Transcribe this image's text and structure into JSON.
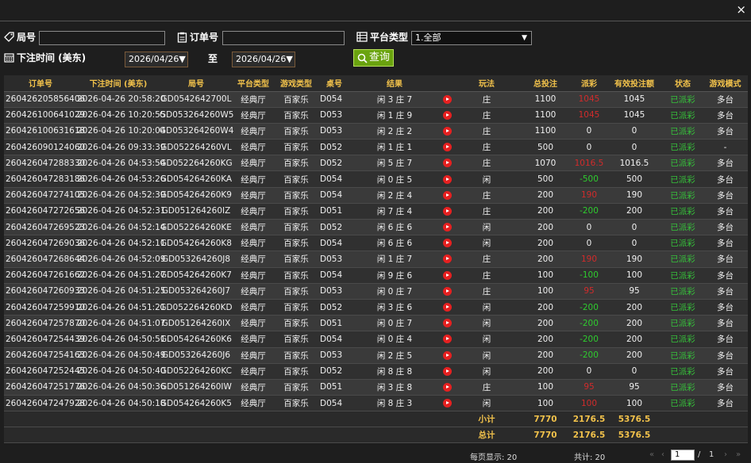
{
  "window": {
    "close_label": "×"
  },
  "filters": {
    "round_label": "局号",
    "order_label": "订单号",
    "platform_label": "平台类型",
    "platform_value": "1.全部",
    "time_label": "下注时间 (美东)",
    "date_from": "2026/04/26▼",
    "to_label": "至",
    "date_to": "2026/04/26▼",
    "query_label": "查询"
  },
  "table": {
    "headers": [
      "订单号",
      "下注时间 (美东)",
      "局号",
      "平台类型",
      "游戏类型",
      "桌号",
      "结果",
      "",
      "玩法",
      "总投注",
      "派彩",
      "有效投注额",
      "状态",
      "游戏模式"
    ],
    "rows": [
      [
        "260426205856406",
        "2026-04-26 20:58:20",
        "GD0542642700L",
        "经典厅",
        "百家乐",
        "D054",
        "闲 3 庄 7",
        "庄",
        "1100",
        "1045",
        "1045",
        "已派彩",
        "多台",
        "red"
      ],
      [
        "260426100641029",
        "2026-04-26 10:20:55",
        "GD053264260W5",
        "经典厅",
        "百家乐",
        "D053",
        "闲 1 庄 9",
        "庄",
        "1100",
        "1045",
        "1045",
        "已派彩",
        "多台",
        "red"
      ],
      [
        "260426100631618",
        "2026-04-26 10:20:04",
        "GD053264260W4",
        "经典厅",
        "百家乐",
        "D053",
        "闲 2 庄 2",
        "庄",
        "1100",
        "0",
        "0",
        "已派彩",
        "多台",
        ""
      ],
      [
        "260426090124060",
        "2026-04-26 09:33:39",
        "GD052264260VL",
        "经典厅",
        "百家乐",
        "D052",
        "闲 1 庄 1",
        "庄",
        "500",
        "0",
        "0",
        "已派彩",
        "-",
        ""
      ],
      [
        "260426047288330",
        "2026-04-26 04:53:54",
        "GD052264260KG",
        "经典厅",
        "百家乐",
        "D052",
        "闲 5 庄 7",
        "庄",
        "1070",
        "1016.5",
        "1016.5",
        "已派彩",
        "多台",
        "red"
      ],
      [
        "260426047283186",
        "2026-04-26 04:53:26",
        "GD054264260KA",
        "经典厅",
        "百家乐",
        "D054",
        "闲 0 庄 5",
        "闲",
        "500",
        "-500",
        "500",
        "已派彩",
        "多台",
        "neg"
      ],
      [
        "260426047274105",
        "2026-04-26 04:52:39",
        "GD054264260K9",
        "经典厅",
        "百家乐",
        "D054",
        "闲 2 庄 4",
        "庄",
        "200",
        "190",
        "190",
        "已派彩",
        "多台",
        "red"
      ],
      [
        "260426047272656",
        "2026-04-26 04:52:31",
        "GD051264260IZ",
        "经典厅",
        "百家乐",
        "D051",
        "闲 7 庄 4",
        "庄",
        "200",
        "-200",
        "200",
        "已派彩",
        "多台",
        "neg"
      ],
      [
        "260426047269523",
        "2026-04-26 04:52:14",
        "GD052264260KE",
        "经典厅",
        "百家乐",
        "D052",
        "闲 6 庄 6",
        "闲",
        "200",
        "0",
        "0",
        "已派彩",
        "多台",
        ""
      ],
      [
        "260426047269036",
        "2026-04-26 04:52:11",
        "GD054264260K8",
        "经典厅",
        "百家乐",
        "D054",
        "闲 6 庄 6",
        "闲",
        "200",
        "0",
        "0",
        "已派彩",
        "多台",
        ""
      ],
      [
        "260426047268644",
        "2026-04-26 04:52:09",
        "GD053264260J8",
        "经典厅",
        "百家乐",
        "D053",
        "闲 1 庄 7",
        "庄",
        "200",
        "190",
        "190",
        "已派彩",
        "多台",
        "red"
      ],
      [
        "260426047261662",
        "2026-04-26 04:51:27",
        "GD054264260K7",
        "经典厅",
        "百家乐",
        "D054",
        "闲 9 庄 6",
        "庄",
        "100",
        "-100",
        "100",
        "已派彩",
        "多台",
        "neg"
      ],
      [
        "260426047260933",
        "2026-04-26 04:51:25",
        "GD053264260J7",
        "经典厅",
        "百家乐",
        "D053",
        "闲 0 庄 7",
        "庄",
        "100",
        "95",
        "95",
        "已派彩",
        "多台",
        "red"
      ],
      [
        "260426047259910",
        "2026-04-26 04:51:21",
        "GD052264260KD",
        "经典厅",
        "百家乐",
        "D052",
        "闲 3 庄 6",
        "闲",
        "200",
        "-200",
        "200",
        "已派彩",
        "多台",
        "neg"
      ],
      [
        "260426047257870",
        "2026-04-26 04:51:07",
        "GD051264260IX",
        "经典厅",
        "百家乐",
        "D051",
        "闲 0 庄 7",
        "闲",
        "200",
        "-200",
        "200",
        "已派彩",
        "多台",
        "neg"
      ],
      [
        "260426047254439",
        "2026-04-26 04:50:51",
        "GD054264260K6",
        "经典厅",
        "百家乐",
        "D054",
        "闲 0 庄 4",
        "闲",
        "200",
        "-200",
        "200",
        "已派彩",
        "多台",
        "neg"
      ],
      [
        "260426047254163",
        "2026-04-26 04:50:49",
        "GD053264260J6",
        "经典厅",
        "百家乐",
        "D053",
        "闲 2 庄 5",
        "闲",
        "200",
        "-200",
        "200",
        "已派彩",
        "多台",
        "neg"
      ],
      [
        "260426047252445",
        "2026-04-26 04:50:40",
        "GD052264260KC",
        "经典厅",
        "百家乐",
        "D052",
        "闲 8 庄 8",
        "闲",
        "200",
        "0",
        "0",
        "已派彩",
        "多台",
        ""
      ],
      [
        "260426047251776",
        "2026-04-26 04:50:36",
        "GD051264260IW",
        "经典厅",
        "百家乐",
        "D051",
        "闲 3 庄 8",
        "庄",
        "100",
        "95",
        "95",
        "已派彩",
        "多台",
        "red"
      ],
      [
        "260426047247928",
        "2026-04-26 04:50:18",
        "GD054264260K5",
        "经典厅",
        "百家乐",
        "D054",
        "闲 8 庄 3",
        "闲",
        "100",
        "100",
        "100",
        "已派彩",
        "多台",
        "red"
      ]
    ],
    "subtotal": {
      "label": "小计",
      "total_bet": "7770",
      "payout": "2176.5",
      "valid_bet": "5376.5"
    },
    "total": {
      "label": "总计",
      "total_bet": "7770",
      "payout": "2176.5",
      "valid_bet": "5376.5"
    }
  },
  "pager": {
    "per_page_label": "每页显示: 20",
    "total_label": "共计: 20",
    "current_page": "1",
    "sep": "/",
    "total_pages": "1",
    "first": "«",
    "prev": "‹",
    "next": "›",
    "last": "»"
  },
  "colors": {
    "header_text": "#f2c24b",
    "win": "#d12b2b",
    "loss": "#2ecc2e",
    "query_btn": "#6aa30f"
  }
}
